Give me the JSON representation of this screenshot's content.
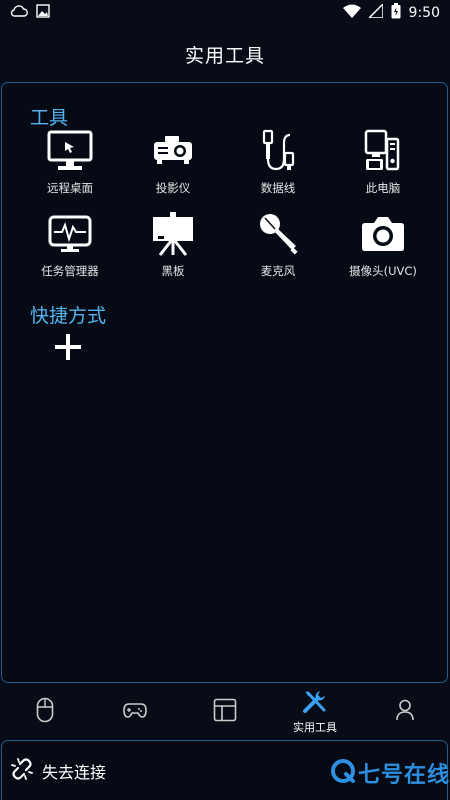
{
  "status_bar": {
    "time": "9:50",
    "left_icons": [
      "cloud-icon",
      "image-icon"
    ],
    "right_icons": [
      "wifi-icon",
      "signal-icon",
      "battery-icon"
    ]
  },
  "header": {
    "title": "实用工具"
  },
  "tools_section": {
    "title": "工具",
    "items": [
      {
        "label": "远程桌面",
        "icon": "monitor-icon"
      },
      {
        "label": "投影仪",
        "icon": "projector-icon"
      },
      {
        "label": "数据线",
        "icon": "usb-cable-icon"
      },
      {
        "label": "此电脑",
        "icon": "computer-icon"
      },
      {
        "label": "任务管理器",
        "icon": "task-manager-icon"
      },
      {
        "label": "黑板",
        "icon": "blackboard-icon"
      },
      {
        "label": "麦克风",
        "icon": "microphone-icon"
      },
      {
        "label": "摄像头(UVC)",
        "icon": "camera-icon"
      }
    ]
  },
  "shortcuts_section": {
    "title": "快捷方式",
    "add_icon": "plus-icon"
  },
  "bottom_nav": {
    "items": [
      {
        "icon": "mouse-icon",
        "label": ""
      },
      {
        "icon": "gamepad-icon",
        "label": ""
      },
      {
        "icon": "layout-icon",
        "label": ""
      },
      {
        "icon": "tools-icon",
        "label": "实用工具",
        "active": true
      },
      {
        "icon": "user-icon",
        "label": ""
      }
    ]
  },
  "connection": {
    "status": "失去连接",
    "icon": "broken-link-icon"
  },
  "watermark": {
    "text": "七号在线"
  },
  "colors": {
    "accent": "#55b4f0",
    "border": "#1f5f8f",
    "background": "#070c16",
    "active": "#3aa0f0"
  }
}
